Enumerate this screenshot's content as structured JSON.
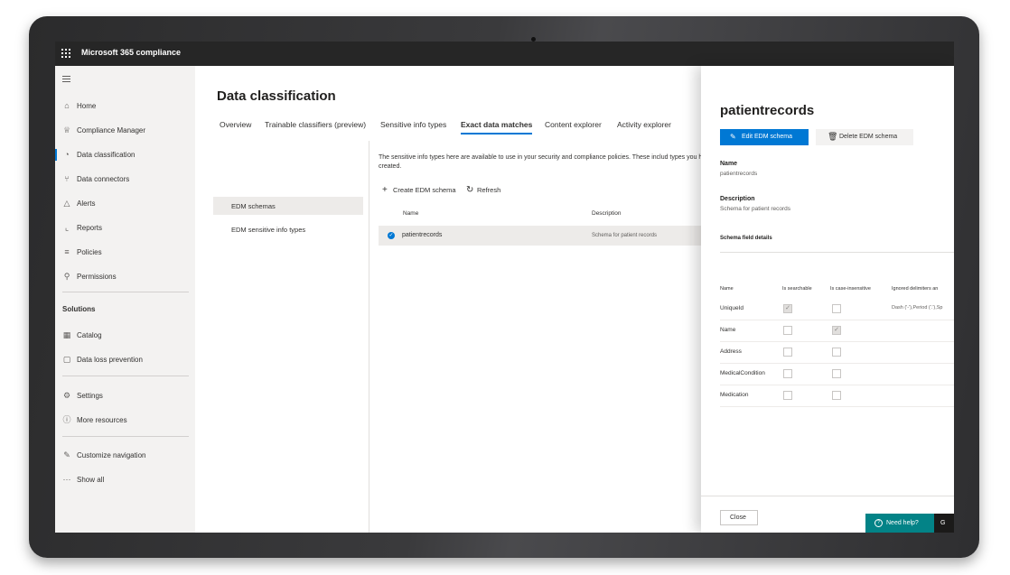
{
  "topbar": {
    "app_title": "Microsoft 365 compliance"
  },
  "leftnav": {
    "items": [
      {
        "label": "Home",
        "icon": "home-icon",
        "glyph": "⌂"
      },
      {
        "label": "Compliance Manager",
        "icon": "trophy-icon",
        "glyph": "♕"
      },
      {
        "label": "Data classification",
        "icon": "classification-icon",
        "glyph": "◔",
        "active": true
      },
      {
        "label": "Data connectors",
        "icon": "connector-icon",
        "glyph": "⑂"
      },
      {
        "label": "Alerts",
        "icon": "alert-icon",
        "glyph": "△"
      },
      {
        "label": "Reports",
        "icon": "chart-icon",
        "glyph": "⌞"
      },
      {
        "label": "Policies",
        "icon": "policy-icon",
        "glyph": "≡"
      },
      {
        "label": "Permissions",
        "icon": "permissions-icon",
        "glyph": "⚲"
      }
    ],
    "solutions_header": "Solutions",
    "solutions": [
      {
        "label": "Catalog",
        "icon": "catalog-icon",
        "glyph": "▦"
      },
      {
        "label": "Data loss prevention",
        "icon": "dlp-icon",
        "glyph": "▢"
      }
    ],
    "bottom": [
      {
        "label": "Settings",
        "icon": "gear-icon",
        "glyph": "⚙"
      },
      {
        "label": "More resources",
        "icon": "info-icon",
        "glyph": "ⓘ"
      }
    ],
    "footer": [
      {
        "label": "Customize navigation",
        "icon": "pencil-icon",
        "glyph": "✎"
      },
      {
        "label": "Show all",
        "icon": "more-icon",
        "glyph": "···"
      }
    ]
  },
  "main": {
    "title": "Data classification",
    "tabs": [
      "Overview",
      "Trainable classifiers (preview)",
      "Sensitive info types",
      "Exact data matches",
      "Content explorer",
      "Activity explorer"
    ],
    "selected_tab": "Exact data matches",
    "subnav": [
      "EDM schemas",
      "EDM sensitive info types"
    ],
    "description": "The sensitive info types here are available to use in your security and compliance policies. These includ types you have created.",
    "commands": {
      "create": "Create EDM schema",
      "refresh": "Refresh"
    },
    "columns": {
      "name": "Name",
      "description": "Description"
    },
    "rows": [
      {
        "name": "patientrecords",
        "description": "Schema for patient records"
      }
    ]
  },
  "panel": {
    "title": "patientrecords",
    "edit_button": "Edit EDM schema",
    "delete_button": "Delete EDM schema",
    "name_label": "Name",
    "name_value": "patientrecords",
    "description_label": "Description",
    "description_value": "Schema for patient records",
    "fields_header": "Schema field details",
    "field_columns": [
      "Name",
      "Is searchable",
      "Is case-insensitive",
      "Ignored delimiters an"
    ],
    "fields": [
      {
        "name": "UniqueId",
        "searchable": true,
        "case_insensitive": false,
        "delimiters": "Dash ('-'),Period ('.'),Sp"
      },
      {
        "name": "Name",
        "searchable": false,
        "case_insensitive": true,
        "delimiters": ""
      },
      {
        "name": "Address",
        "searchable": false,
        "case_insensitive": false,
        "delimiters": ""
      },
      {
        "name": "MedicalCondition",
        "searchable": false,
        "case_insensitive": false,
        "delimiters": ""
      },
      {
        "name": "Medication",
        "searchable": false,
        "case_insensitive": false,
        "delimiters": ""
      }
    ],
    "close_button": "Close",
    "help_button": "Need help?",
    "help_extra": "G"
  },
  "colors": {
    "accent": "#0078d4",
    "topbar": "#262626",
    "help": "#038387",
    "nav_bg": "#f3f2f1"
  }
}
